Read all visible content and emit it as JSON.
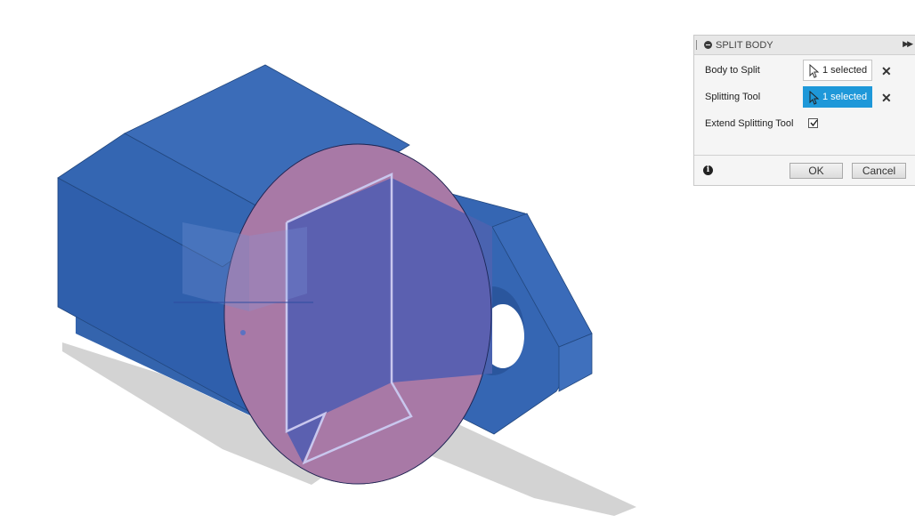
{
  "panel": {
    "title": "SPLIT BODY",
    "rows": [
      {
        "label": "Body to Split",
        "value": "1 selected"
      },
      {
        "label": "Splitting Tool",
        "value": "1 selected"
      }
    ],
    "extend_label": "Extend Splitting Tool",
    "extend_checked": true,
    "ok_label": "OK",
    "cancel_label": "Cancel"
  },
  "colors": {
    "body_blue": "#3a68b4",
    "selection_highlight": "#1e98d9",
    "split_plane": "#6a5fb0",
    "split_overlap": "#f49a9a"
  }
}
